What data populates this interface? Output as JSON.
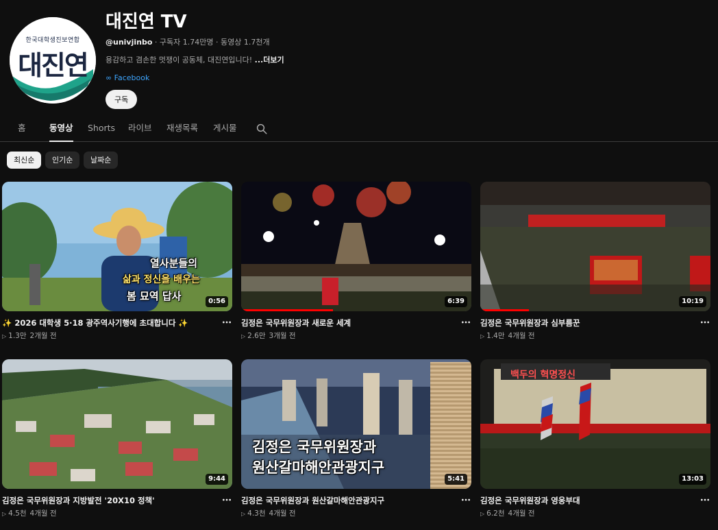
{
  "channel": {
    "avatar_small_text": "한국대학생진보연합",
    "avatar_big_text": "대진연",
    "title": "대진연 TV",
    "handle": "@univjinbo",
    "subscribers": "구독자 1.74만명",
    "video_count": "동영상 1.7천개",
    "description": "용감하고 겸손한 멋쟁이 공동체, 대진연입니다!",
    "more_label": "...더보기",
    "link_label": "Facebook",
    "subscribe_label": "구독"
  },
  "tabs": [
    {
      "label": "홈"
    },
    {
      "label": "동영상"
    },
    {
      "label": "Shorts"
    },
    {
      "label": "라이브"
    },
    {
      "label": "재생목록"
    },
    {
      "label": "게시물"
    }
  ],
  "chips": [
    {
      "label": "최신순"
    },
    {
      "label": "인기순"
    },
    {
      "label": "날짜순"
    }
  ],
  "videos": [
    {
      "title": "✨ 2026 대학생 5·18 광주역사기행에 초대합니다 ✨",
      "views": "1.3만",
      "date": "2개월 전",
      "duration": "0:56",
      "overlay": [
        "열사분들의",
        "삶과 정신을 배우는",
        "봄 묘역 답사"
      ]
    },
    {
      "title": "김정은 국무위원장과 새로운 세계",
      "views": "2.6만",
      "date": "3개월 전",
      "duration": "6:39",
      "progress": 0.4
    },
    {
      "title": "김정은 국무위원장과 심부름꾼",
      "views": "1.4만",
      "date": "4개월 전",
      "duration": "10:19",
      "progress": 0.21
    },
    {
      "title": "김정은 국무위원장과 지방발전 '20X10 정책'",
      "views": "4.5천",
      "date": "4개월 전",
      "duration": "9:44"
    },
    {
      "title": "김정은 국무위원장과 원산갈마해안관광지구",
      "views": "4.3천",
      "date": "4개월 전",
      "duration": "5:41",
      "overlay": [
        "김정은 국무위원장과",
        "원산갈마해안관광지구"
      ]
    },
    {
      "title": "김정은 국무위원장과 영웅부대",
      "views": "6.2천",
      "date": "4개월 전",
      "duration": "13:03",
      "overlay": [
        "백두의 혁명정신"
      ]
    }
  ],
  "colors": {
    "background": "#0f0f0f",
    "link": "#3ea6ff",
    "progress": "#ff0000"
  }
}
